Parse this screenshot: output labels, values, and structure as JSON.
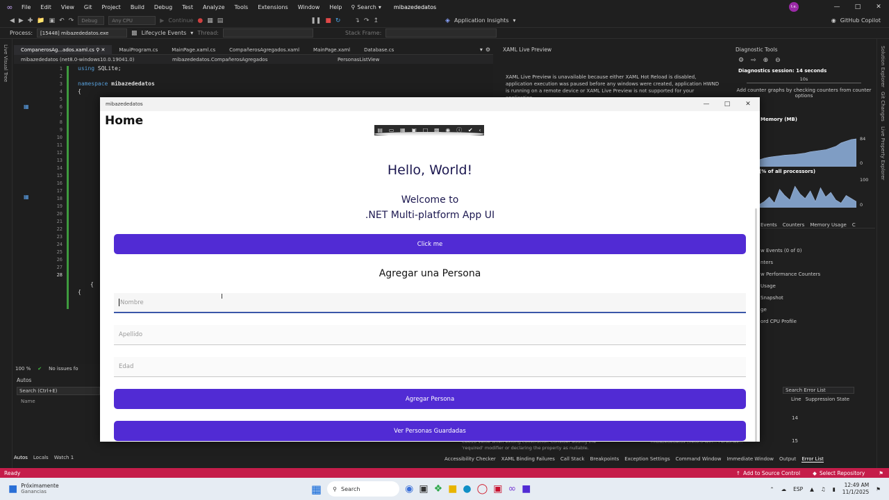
{
  "menubar": {
    "items": [
      "File",
      "Edit",
      "View",
      "Git",
      "Project",
      "Build",
      "Debug",
      "Test",
      "Analyze",
      "Tools",
      "Extensions",
      "Window",
      "Help"
    ],
    "search_label": "Search",
    "project_title": "mibazededatos",
    "avatar_text": "t.e."
  },
  "toolbar": {
    "config": "Debug",
    "platform": "Any CPU",
    "continue_label": "Continue",
    "app_insights": "Application Insights",
    "copilot": "GitHub Copilot"
  },
  "toolbar2": {
    "process_label": "Process:",
    "process_value": "[15448] mibazededatos.exe",
    "lifecycle": "Lifecycle Events",
    "thread_label": "Thread:",
    "stack_frame": "Stack Frame:"
  },
  "left_rail": {
    "label": "Live Visual Tree"
  },
  "right_rail": {
    "labels": [
      "Solution Explorer",
      "Git Changes",
      "Live Property Explorer"
    ]
  },
  "editor_tabs": [
    "CompanerosAg...ados.xaml.cs",
    "MauiProgram.cs",
    "MainPage.xaml.cs",
    "CompañerosAgregados.xaml",
    "MainPage.xaml",
    "Database.cs"
  ],
  "navbar": {
    "project": "mibazededatos (net8.0-windows10.0.19041.0)",
    "class": "mibazededatos.CompañerosAgregados",
    "member": "PersonasListView"
  },
  "code": {
    "line_numbers": [
      "1",
      "2",
      "3",
      "4",
      "5",
      "6",
      "7",
      "8",
      "9",
      "10",
      "11",
      "12",
      "13",
      "14",
      "15",
      "16",
      "17",
      "18",
      "19",
      "20",
      "21",
      "22",
      "23",
      "24",
      "25",
      "26",
      "27",
      "28"
    ],
    "line1_kw": "using",
    "line1_rest": " SQLite;",
    "line3_kw": "namespace",
    "line3_rest": " mibazededatos",
    "line4": "{"
  },
  "editor_status": {
    "zoom": "100 %",
    "issues": "No issues fo"
  },
  "autos": {
    "title": "Autos",
    "search": "Search (Ctrl+E)",
    "col_name": "Name",
    "tabs": [
      "Autos",
      "Locals",
      "Watch 1"
    ]
  },
  "xaml_preview": {
    "title": "XAML Live Preview",
    "message": "XAML Live Preview is unavailable because either XAML Hot Reload is disabled, application execution was paused before any windows were created, application HWND is running on a remote device or XAML Live Preview is not supported for your application."
  },
  "diagnostics": {
    "title": "Diagnostic Tools",
    "session": "Diagnostics session: 14 seconds",
    "timeline_label": "10s",
    "hint": "Add counter graphs by checking counters from counter options",
    "memory_label": "Memory (MB)",
    "mem_max": "84",
    "mem_min": "0",
    "cpu_label": "(% of all processors)",
    "cpu_max": "100",
    "cpu_min": "0",
    "tabs": [
      "Events",
      "Counters",
      "Memory Usage",
      "C"
    ],
    "rows": [
      "w Events (0 of 0)",
      "nters",
      "w Performance Counters",
      "Usage",
      "Snapshot",
      "ge",
      "ord CPU Profile"
    ],
    "cpu_series": [
      10,
      20,
      35,
      15,
      60,
      40,
      25,
      70,
      45,
      30,
      55,
      20,
      65,
      35,
      50,
      25,
      15,
      40,
      30,
      20
    ],
    "mem_series": [
      20,
      25,
      28,
      30,
      32,
      34,
      35,
      36,
      38,
      40,
      44,
      46,
      48,
      50,
      55,
      60,
      70,
      75,
      80,
      82
    ]
  },
  "errorlist": {
    "search": "Search Error List",
    "col_line": "Line",
    "col_supp": "Suppression State",
    "line1": "14",
    "line2": "15",
    "snippet1": "C8618   Value when exiting constructor. Consider adding the",
    "snippet2": "'required' modifier or declaring the property as nullable.",
    "snippet3": "mibazededatos (net8.0-win...  Personas..."
  },
  "bottom_tabs_right": [
    "Accessibility Checker",
    "XAML Binding Failures",
    "Call Stack",
    "Breakpoints",
    "Exception Settings",
    "Command Window",
    "Immediate Window",
    "Output",
    "Error List"
  ],
  "statusbar": {
    "ready": "Ready",
    "add_source": "Add to Source Control",
    "select_repo": "Select Repository"
  },
  "taskbar": {
    "weather_title": "Próximamente",
    "weather_sub": "Ganancias",
    "search": "Search",
    "lang": "ESP",
    "time": "12:49 AM",
    "date": "11/1/2025"
  },
  "app": {
    "window_title": "mibazededatos",
    "home_title": "Home",
    "hello": "Hello, World!",
    "welcome_line1": "Welcome to",
    "welcome_line2": ".NET Multi-platform App UI",
    "click_me": "Click me",
    "add_heading": "Agregar una Persona",
    "nombre_placeholder": "Nombre",
    "apellido_placeholder": "Apellido",
    "edad_placeholder": "Edad",
    "add_button": "Agregar Persona",
    "view_button": "Ver Personas Guardadas"
  },
  "colors": {
    "maui_purple": "#512bd4",
    "status_red": "#c51d4a",
    "heading_navy": "#1c1850"
  }
}
